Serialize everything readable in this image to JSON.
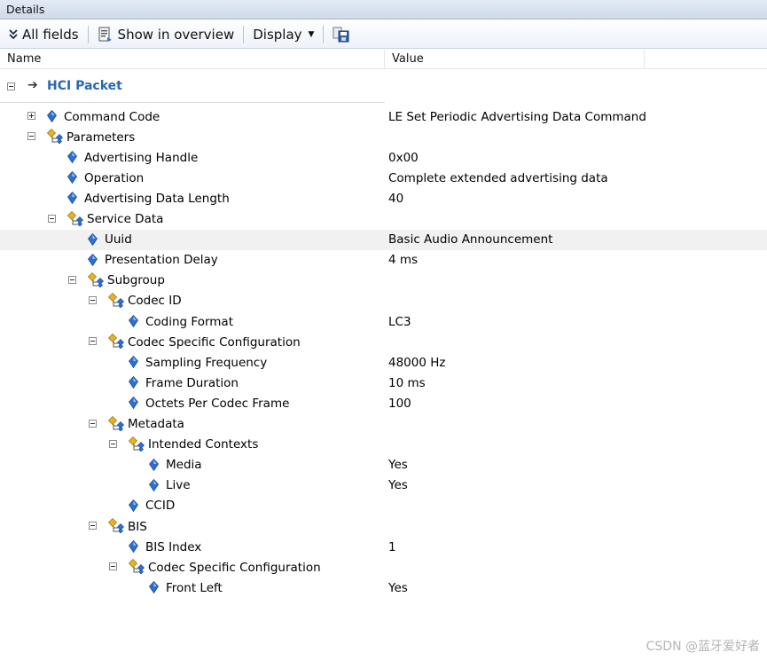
{
  "window": {
    "title": "Details"
  },
  "toolbar": {
    "all_fields": "All fields",
    "show_in_overview": "Show in overview",
    "display": "Display"
  },
  "columns": {
    "name": "Name",
    "value": "Value"
  },
  "root": {
    "label": "HCI Packet"
  },
  "rows": [
    {
      "label": "Command Code",
      "value": "LE Set Periodic Advertising Data Command",
      "icon": "field-icon",
      "expander": "plus"
    },
    {
      "label": "Parameters",
      "value": "",
      "icon": "group-icon",
      "expander": "minus"
    },
    {
      "label": "Advertising Handle",
      "value": "0x00",
      "icon": "field-icon",
      "expander": ""
    },
    {
      "label": "Operation",
      "value": "Complete extended advertising data",
      "icon": "field-icon",
      "expander": ""
    },
    {
      "label": "Advertising Data Length",
      "value": "40",
      "icon": "field-icon",
      "expander": ""
    },
    {
      "label": "Service Data",
      "value": "",
      "icon": "group-icon",
      "expander": "minus"
    },
    {
      "label": "Uuid",
      "value": "Basic Audio Announcement",
      "icon": "field-icon",
      "expander": "",
      "selected": true
    },
    {
      "label": "Presentation Delay",
      "value": "4 ms",
      "icon": "field-icon",
      "expander": ""
    },
    {
      "label": "Subgroup",
      "value": "",
      "icon": "group-icon",
      "expander": "minus"
    },
    {
      "label": "Codec ID",
      "value": "",
      "icon": "group-icon",
      "expander": "minus"
    },
    {
      "label": "Coding Format",
      "value": "LC3",
      "icon": "field-icon",
      "expander": ""
    },
    {
      "label": "Codec Specific Configuration",
      "value": "",
      "icon": "group-icon",
      "expander": "minus"
    },
    {
      "label": "Sampling Frequency",
      "value": "48000 Hz",
      "icon": "field-icon",
      "expander": ""
    },
    {
      "label": "Frame Duration",
      "value": "10 ms",
      "icon": "field-icon",
      "expander": ""
    },
    {
      "label": "Octets Per Codec Frame",
      "value": "100",
      "icon": "field-icon",
      "expander": ""
    },
    {
      "label": "Metadata",
      "value": "",
      "icon": "group-icon",
      "expander": "minus"
    },
    {
      "label": "Intended Contexts",
      "value": "",
      "icon": "group-icon",
      "expander": "minus"
    },
    {
      "label": "Media",
      "value": "Yes",
      "icon": "field-icon",
      "expander": ""
    },
    {
      "label": "Live",
      "value": "Yes",
      "icon": "field-icon",
      "expander": ""
    },
    {
      "label": "CCID",
      "value": "",
      "icon": "field-icon",
      "expander": ""
    },
    {
      "label": "BIS",
      "value": "",
      "icon": "group-icon",
      "expander": "minus"
    },
    {
      "label": "BIS Index",
      "value": "1",
      "icon": "field-icon",
      "expander": ""
    },
    {
      "label": "Codec Specific Configuration",
      "value": "",
      "icon": "group-icon",
      "expander": "minus"
    },
    {
      "label": "Front Left",
      "value": "Yes",
      "icon": "field-icon",
      "expander": ""
    }
  ],
  "watermark": "CSDN @蓝牙爱好者",
  "colors": {
    "accent": "#2a67b5",
    "field_icon": "#2f6fd0",
    "group_icon": "#e6b325",
    "selected_row": "#f1f1f1"
  }
}
